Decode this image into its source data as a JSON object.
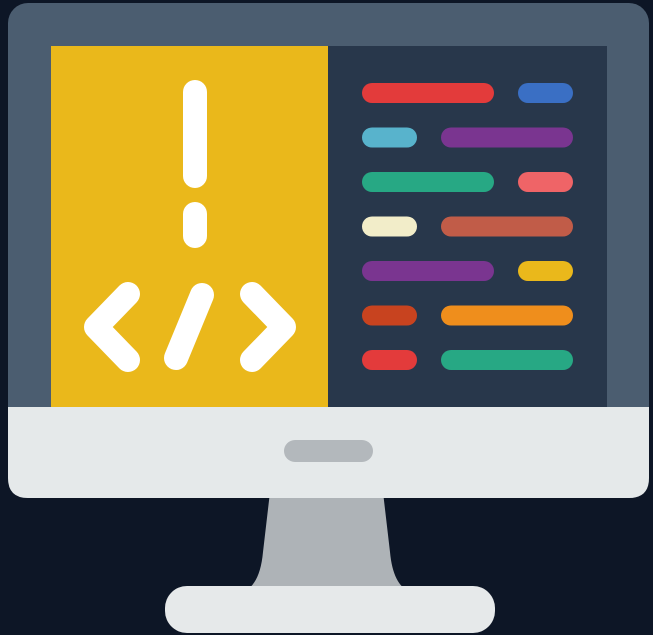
{
  "illustration": {
    "subject": "coding-monitor-icon",
    "colors": {
      "background": "#0d1626",
      "monitor_frame": "#4b5d70",
      "screen_dark": "#28374b",
      "panel_yellow": "#eab81b",
      "chin": "#e5e9ea",
      "chin_button": "#b3b8bc",
      "stand": "#aeb3b7",
      "base": "#e6e9ea",
      "glyph_white": "#ffffff"
    },
    "code_lines": [
      {
        "colors": [
          "#e33b3b",
          "#3a6fc4"
        ]
      },
      {
        "colors": [
          "#58b3cc",
          "#7a3590"
        ]
      },
      {
        "colors": [
          "#27a884",
          "#ef6467"
        ]
      },
      {
        "colors": [
          "#f2edc9",
          "#c15c48"
        ]
      },
      {
        "colors": [
          "#7a3590",
          "#eab81b"
        ]
      },
      {
        "colors": [
          "#c8431f",
          "#ef8e1c"
        ]
      },
      {
        "colors": [
          "#e33b3b",
          "#27a884"
        ]
      }
    ]
  }
}
